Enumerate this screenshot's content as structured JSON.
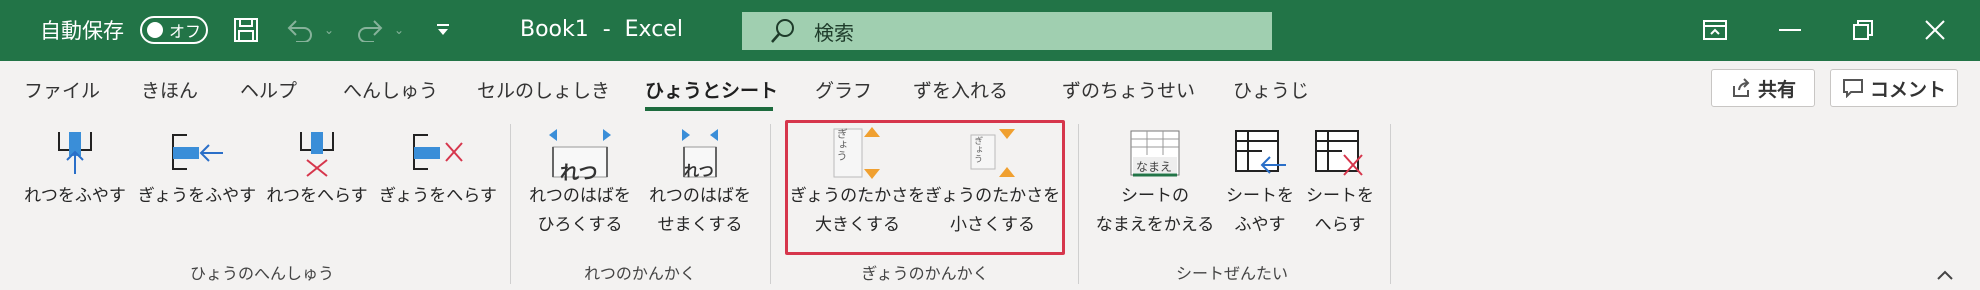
{
  "titlebar": {
    "autosave_label": "自動保存",
    "autosave_state": "オフ",
    "doc_title": "Book1  -  Excel",
    "search_placeholder": "検索",
    "bg_color": "#227447"
  },
  "tabs": [
    {
      "label": "ファイル"
    },
    {
      "label": "きほん"
    },
    {
      "label": "ヘルプ"
    },
    {
      "label": "へんしゅう"
    },
    {
      "label": "セルのしょしき"
    },
    {
      "label": "ひょうとシート",
      "active": true
    },
    {
      "label": "グラフ"
    },
    {
      "label": "ずを入れる"
    },
    {
      "label": "ずのちょうせい"
    },
    {
      "label": "ひょうじ"
    }
  ],
  "share_label": "共有",
  "comment_label": "コメント",
  "groups": {
    "table_edit": {
      "label": "ひょうのへんしゅう",
      "commands": [
        "れつをふやす",
        "ぎょうをふやす",
        "れつをへらす",
        "ぎょうをへらす"
      ]
    },
    "col_spacing": {
      "label": "れつのかんかく",
      "commands": [
        [
          "れつのはばを",
          "ひろくする"
        ],
        [
          "れつのはばを",
          "せまくする"
        ]
      ],
      "icon_text": "れつ"
    },
    "row_spacing": {
      "label": "ぎょうのかんかく",
      "commands": [
        [
          "ぎょうのたかさを",
          "大きくする"
        ],
        [
          "ぎょうのたかさを",
          "小さくする"
        ]
      ],
      "icon_text": "ぎょう",
      "highlight_color": "#d6364c"
    },
    "sheet_ops": {
      "label": "シートぜんたい",
      "commands": [
        [
          "シートの",
          "なまえをかえる"
        ],
        [
          "シートを",
          "ふやす"
        ],
        [
          "シートを",
          "へらす"
        ]
      ],
      "icon_text": "なまえ"
    }
  }
}
